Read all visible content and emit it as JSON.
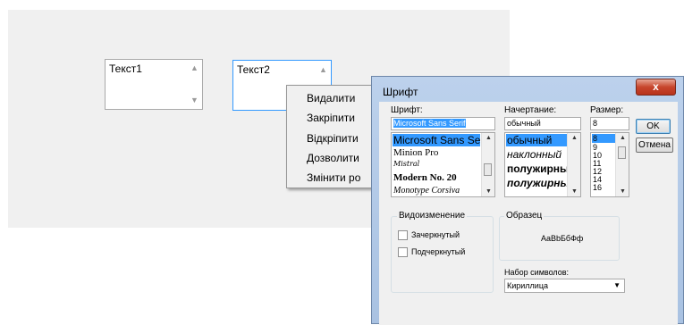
{
  "form": {
    "textbox1": {
      "value": "Текст1"
    },
    "textbox2": {
      "value": "Текст2"
    }
  },
  "context_menu": {
    "items": [
      "Видалити",
      "Закріпити",
      "Відкріпити",
      "Дозволити",
      "Змінити ро"
    ]
  },
  "font_dialog": {
    "title": "Шрифт",
    "close_label": "x",
    "font_label": "Шрифт:",
    "font_value": "Microsoft Sans Serif",
    "font_list": [
      "Microsoft Sans Serif",
      "Minion Pro",
      "Mistral",
      "Modern No. 20",
      "Monotype Corsiva"
    ],
    "style_label": "Начертание:",
    "style_value": "обычный",
    "style_list": [
      "обычный",
      "наклонный",
      "полужирный",
      "полужирный"
    ],
    "size_label": "Размер:",
    "size_value": "8",
    "size_list": [
      "8",
      "9",
      "10",
      "11",
      "12",
      "14",
      "16"
    ],
    "ok_label": "OK",
    "cancel_label": "Отмена",
    "effects_label": "Видоизменение",
    "strikeout_label": "Зачеркнутый",
    "underline_label": "Подчеркнутый",
    "sample_label": "Образец",
    "sample_text": "AaBbБбФф",
    "charset_label": "Набор символов:",
    "charset_value": "Кириллица"
  },
  "colors": {
    "canvas_bg": "#f0f0f0",
    "selection": "#3399ff",
    "close_button": "#c7452c"
  }
}
